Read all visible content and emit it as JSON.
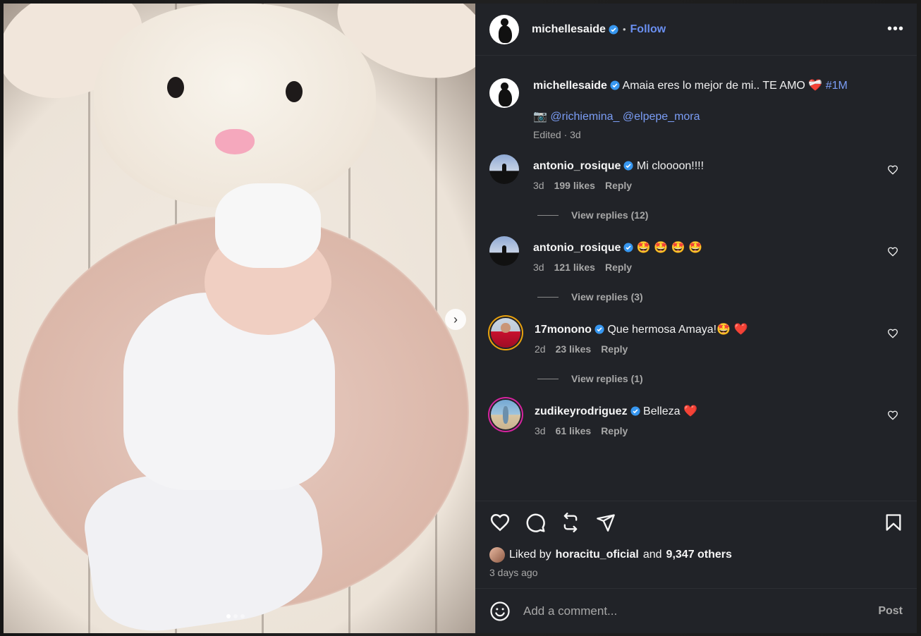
{
  "post": {
    "author": "michellesaide",
    "follow_label": "Follow",
    "separator": "•",
    "more_label": "•••",
    "caption_text": "Amaia eres lo mejor de mi.. TE AMO ❤️‍🩹",
    "caption_hashtag": "#1M",
    "credit_icon": "📷",
    "credit_mention_1": "@richiemina_",
    "credit_mention_2": "@elpepe_mora",
    "caption_meta": "Edited · 3d",
    "slide_count": 3,
    "active_slide": 1
  },
  "comments": [
    {
      "username": "antonio_rosique",
      "text": "Mi cloooon!!!!",
      "age": "3d",
      "likes": "199 likes",
      "reply_label": "Reply",
      "view_replies": "View replies (12)",
      "avatar": "silhouette-sky"
    },
    {
      "username": "antonio_rosique",
      "text": "🤩 🤩 🤩 🤩",
      "age": "3d",
      "likes": "121 likes",
      "reply_label": "Reply",
      "view_replies": "View replies (3)",
      "avatar": "silhouette-sky"
    },
    {
      "username": "17monono",
      "text": "Que hermosa Amaya!🤩 ❤️",
      "age": "2d",
      "likes": "23 likes",
      "reply_label": "Reply",
      "view_replies": "View replies (1)",
      "avatar": "person-red-shirt"
    },
    {
      "username": "zudikeyrodriguez",
      "text": "Belleza ❤️",
      "age": "3d",
      "likes": "61 likes",
      "reply_label": "Reply",
      "avatar": "beach"
    }
  ],
  "likes": {
    "prefix": "Liked by",
    "user": "horacitu_oficial",
    "middle": "and",
    "others": "9,347 others"
  },
  "timestamp": "3 days ago",
  "composer": {
    "placeholder": "Add a comment...",
    "post_label": "Post"
  },
  "icons": {
    "verified": "verified-badge-icon",
    "like": "heart-icon",
    "comment": "comment-icon",
    "repost": "repost-icon",
    "share": "share-icon",
    "save": "bookmark-icon",
    "emoji": "emoji-icon",
    "next": "chevron-right-icon"
  },
  "colors": {
    "panel_bg": "#212328",
    "link_blue": "#6a8ff0",
    "verified_blue": "#3797f0",
    "muted_text": "#a8a8a8"
  }
}
